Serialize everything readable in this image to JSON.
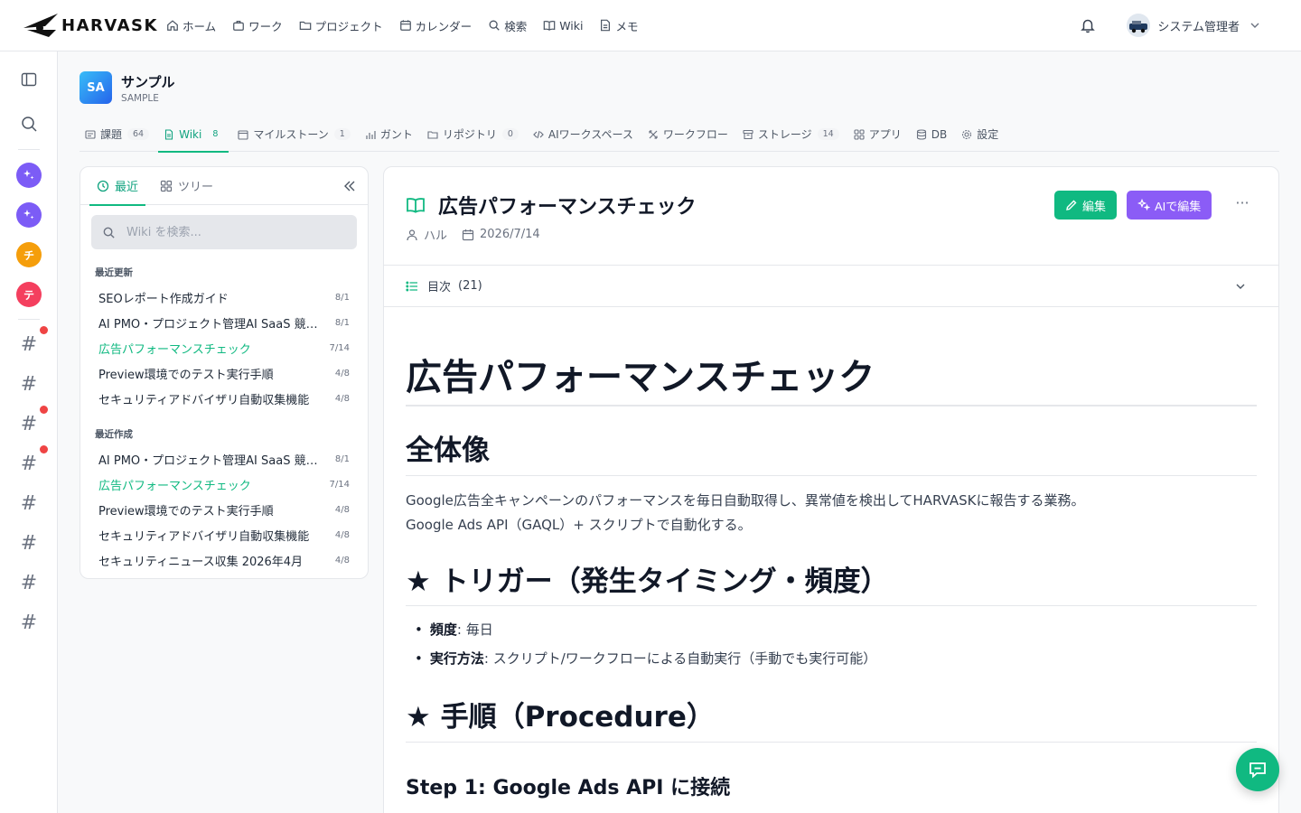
{
  "brand": {
    "name": "HARVASK"
  },
  "topnav": [
    {
      "label": "ホーム",
      "icon": "home-icon"
    },
    {
      "label": "ワーク",
      "icon": "briefcase-icon"
    },
    {
      "label": "プロジェクト",
      "icon": "folder-icon"
    },
    {
      "label": "カレンダー",
      "icon": "calendar-icon"
    },
    {
      "label": "検索",
      "icon": "search-icon"
    },
    {
      "label": "Wiki",
      "icon": "book-icon"
    },
    {
      "label": "メモ",
      "icon": "note-icon"
    }
  ],
  "user": {
    "name": "システム管理者"
  },
  "rail": {
    "channels": [
      {
        "initial": "チ",
        "color": "#f59e0b"
      },
      {
        "initial": "テ",
        "color": "#f43f5e"
      }
    ],
    "hash_symbol": "#"
  },
  "project": {
    "badge": "SA",
    "name": "サンプル",
    "key": "SAMPLE"
  },
  "tabs": [
    {
      "label": "課題",
      "count": "64"
    },
    {
      "label": "Wiki",
      "count": "8"
    },
    {
      "label": "マイルストーン",
      "count": "1"
    },
    {
      "label": "ガント",
      "count": ""
    },
    {
      "label": "リポジトリ",
      "count": "0"
    },
    {
      "label": "AIワークスペース",
      "count": ""
    },
    {
      "label": "ワークフロー",
      "count": ""
    },
    {
      "label": "ストレージ",
      "count": "14"
    },
    {
      "label": "アプリ",
      "count": ""
    },
    {
      "label": "DB",
      "count": ""
    },
    {
      "label": "設定",
      "count": ""
    }
  ],
  "wiki_panel": {
    "tab_recent": "最近",
    "tab_tree": "ツリー",
    "search_placeholder": "Wiki を検索...",
    "section_updated": "最近更新",
    "section_created": "最近作成",
    "updated": [
      {
        "title": "SEOレポート作成ガイド",
        "date": "8/1"
      },
      {
        "title": "AI PMO・プロジェクト管理AI SaaS 競合調査",
        "date": "8/1"
      },
      {
        "title": "広告パフォーマンスチェック",
        "date": "7/14"
      },
      {
        "title": "Preview環境でのテスト実行手順",
        "date": "4/8"
      },
      {
        "title": "セキュリティアドバイザリ自動収集機能",
        "date": "4/8"
      }
    ],
    "created": [
      {
        "title": "AI PMO・プロジェクト管理AI SaaS 競合調査",
        "date": "8/1"
      },
      {
        "title": "広告パフォーマンスチェック",
        "date": "7/14"
      },
      {
        "title": "Preview環境でのテスト実行手順",
        "date": "4/8"
      },
      {
        "title": "セキュリティアドバイザリ自動収集機能",
        "date": "4/8"
      },
      {
        "title": "セキュリティニュース収集 2026年4月",
        "date": "4/8"
      }
    ]
  },
  "doc": {
    "title": "広告パフォーマンスチェック",
    "author": "ハル",
    "date": "2026/7/14",
    "edit_label": "編集",
    "ai_edit_label": "AIで編集",
    "more_label": "···",
    "toc_label": "目次",
    "toc_count": "(21)",
    "h1": "広告パフォーマンスチェック",
    "h2_overview": "全体像",
    "p1": "Google広告全キャンペーンのパフォーマンスを毎日自動取得し、異常値を検出してHARVASKに報告する業務。",
    "p2": "Google Ads API（GAQL）+ スクリプトで自動化する。",
    "h2_trigger": "★ トリガー（発生タイミング・頻度）",
    "freq_label": "頻度",
    "freq_value": ": 毎日",
    "method_label": "実行方法",
    "method_value": ": スクリプト/ワークフローによる自動実行（手動でも実行可能）",
    "h2_procedure": "★ 手順（Procedure）",
    "h3_step1": "Step 1: Google Ads API に接続"
  },
  "colors": {
    "accent": "#10b981",
    "ai": "#8b5cf6",
    "rail_ai": "#7c5cf6"
  }
}
